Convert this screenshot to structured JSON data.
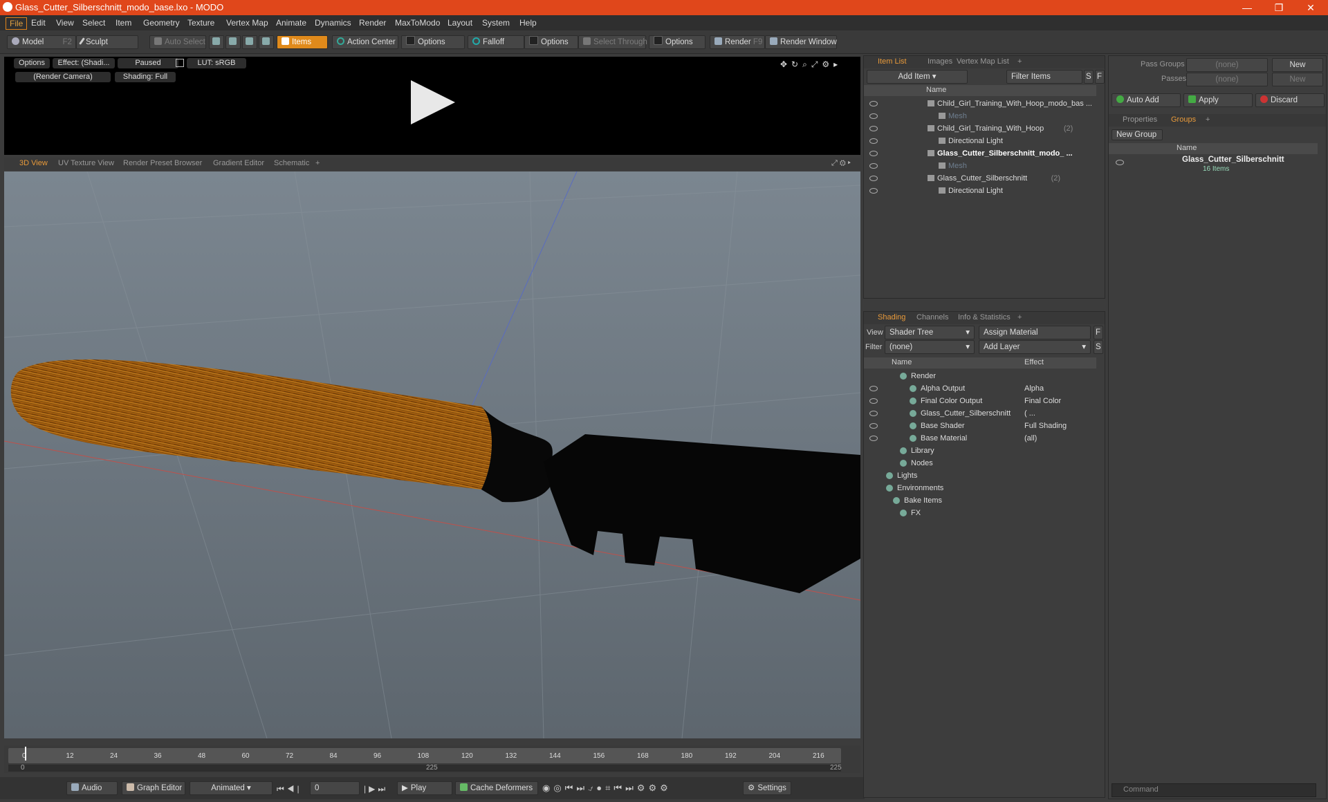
{
  "window": {
    "title": "Glass_Cutter_Silberschnitt_modo_base.lxo - MODO"
  },
  "menu": [
    "File",
    "Edit",
    "View",
    "Select",
    "Item",
    "Geometry",
    "Texture",
    "Vertex Map",
    "Animate",
    "Dynamics",
    "Render",
    "MaxToModo",
    "Layout",
    "System",
    "Help"
  ],
  "toolbar": {
    "model": "Model",
    "model_key": "F2",
    "sculpt": "Sculpt",
    "auto_select": "Auto Select",
    "items": "Items",
    "action_center": "Action Center",
    "options1": "Options",
    "falloff": "Falloff",
    "options2": "Options",
    "select_through": "Select Through",
    "options3": "Options",
    "render": "Render",
    "render_key": "F9",
    "render_window": "Render Window"
  },
  "preview": {
    "options": "Options",
    "effect": "Effect: (Shadi...",
    "paused": "Paused",
    "lut": "LUT: sRGB",
    "camera": "(Render Camera)",
    "shading": "Shading: Full"
  },
  "viewport_tabs": [
    "3D View",
    "UV Texture View",
    "Render Preset Browser",
    "Gradient Editor",
    "Schematic",
    "+"
  ],
  "timeline": {
    "ticks": [
      "0",
      "12",
      "24",
      "36",
      "48",
      "60",
      "72",
      "84",
      "96",
      "108",
      "120",
      "132",
      "144",
      "156",
      "168",
      "180",
      "192",
      "204",
      "216"
    ],
    "range_start": "0",
    "range_mid": "225",
    "range_end": "225"
  },
  "bottombar": {
    "audio": "Audio",
    "graph_editor": "Graph Editor",
    "animated": "Animated",
    "frame": "0",
    "play": "Play",
    "cache": "Cache Deformers",
    "settings": "Settings"
  },
  "itemlist": {
    "tabs": [
      "Item List",
      "Images",
      "Vertex Map List",
      "+"
    ],
    "add_item": "Add Item",
    "filter": "Filter Items",
    "s": "S",
    "f": "F",
    "col_name": "Name",
    "rows": [
      {
        "label": "Child_Girl_Training_With_Hoop_modo_bas ...",
        "count": "",
        "bold": false,
        "dim": false
      },
      {
        "label": "Mesh",
        "count": "",
        "bold": false,
        "dim": true
      },
      {
        "label": "Child_Girl_Training_With_Hoop",
        "count": "(2)",
        "bold": false,
        "dim": false
      },
      {
        "label": "Directional Light",
        "count": "",
        "bold": false,
        "dim": false
      },
      {
        "label": "Glass_Cutter_Silberschnitt_modo_ ...",
        "count": "",
        "bold": true,
        "dim": false
      },
      {
        "label": "Mesh",
        "count": "",
        "bold": false,
        "dim": true
      },
      {
        "label": "Glass_Cutter_Silberschnitt",
        "count": "(2)",
        "bold": false,
        "dim": false
      },
      {
        "label": "Directional Light",
        "count": "",
        "bold": false,
        "dim": false
      }
    ]
  },
  "shading": {
    "tabs": [
      "Shading",
      "Channels",
      "Info & Statistics",
      "+"
    ],
    "view_label": "View",
    "view_value": "Shader Tree",
    "assign": "Assign Material",
    "f": "F",
    "filter_label": "Filter",
    "filter_value": "(none)",
    "add_layer": "Add Layer",
    "s": "S",
    "col_name": "Name",
    "col_effect": "Effect",
    "rows": [
      {
        "label": "Render",
        "effect": ""
      },
      {
        "label": "Alpha Output",
        "effect": "Alpha"
      },
      {
        "label": "Final Color Output",
        "effect": "Final Color"
      },
      {
        "label": "Glass_Cutter_Silberschnitt",
        "effect": "( ..."
      },
      {
        "label": "Base Shader",
        "effect": "Full Shading"
      },
      {
        "label": "Base Material",
        "effect": "(all)"
      },
      {
        "label": "Library",
        "effect": ""
      },
      {
        "label": "Nodes",
        "effect": ""
      },
      {
        "label": "Lights",
        "effect": ""
      },
      {
        "label": "Environments",
        "effect": ""
      },
      {
        "label": "Bake Items",
        "effect": ""
      },
      {
        "label": "FX",
        "effect": ""
      }
    ]
  },
  "groups": {
    "pass_groups": "Pass Groups",
    "passes": "Passes",
    "none1": "(none)",
    "none2": "(none)",
    "new1": "New",
    "new2": "New",
    "auto_add": "Auto Add",
    "apply": "Apply",
    "discard": "Discard",
    "tabs": [
      "Properties",
      "Groups",
      "+"
    ],
    "new_group": "New Group",
    "col_name": "Name",
    "item": "Glass_Cutter_Silberschnitt",
    "item_sub": "16 Items"
  },
  "command": {
    "placeholder": "Command"
  },
  "colors": {
    "title": "#e0471b",
    "accent": "#e08a1b"
  }
}
